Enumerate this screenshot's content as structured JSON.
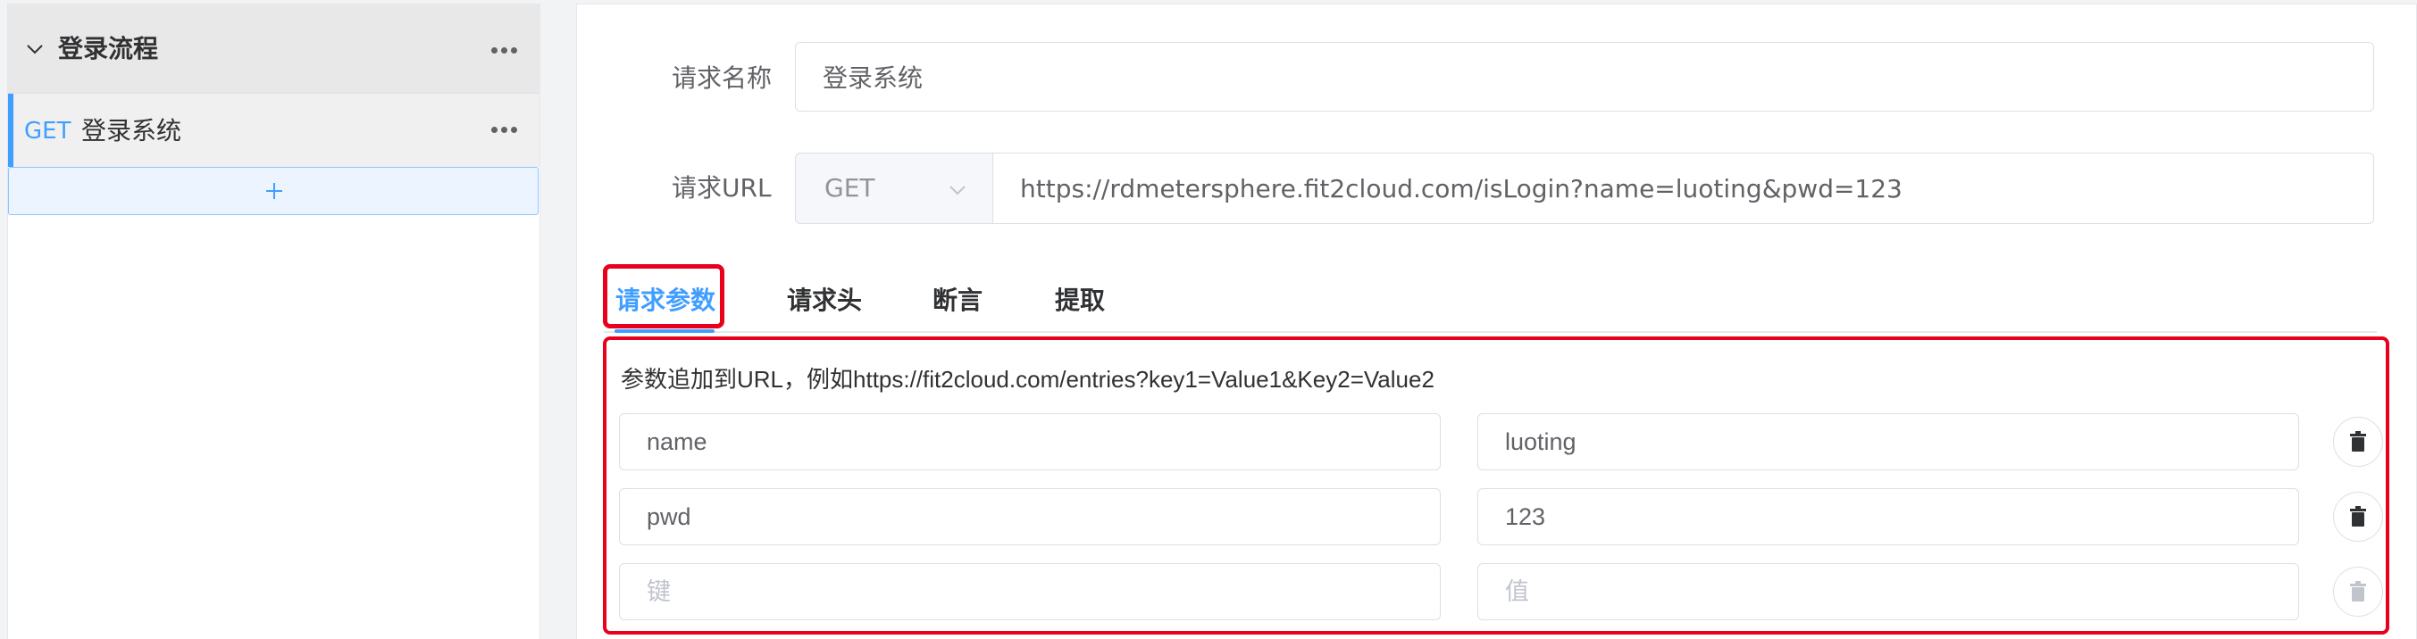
{
  "sidebar": {
    "scenario_title": "登录流程",
    "request": {
      "method": "GET",
      "name": "登录系统"
    }
  },
  "form": {
    "name_label": "请求名称",
    "name_value": "登录系统",
    "url_label": "请求URL",
    "method_value": "GET",
    "url_value": "https://rdmetersphere.fit2cloud.com/isLogin?name=luoting&pwd=123"
  },
  "tabs": [
    {
      "label": "请求参数"
    },
    {
      "label": "请求头"
    },
    {
      "label": "断言"
    },
    {
      "label": "提取"
    }
  ],
  "params": {
    "hint": "参数追加到URL，例如https://fit2cloud.com/entries?key1=Value1&Key2=Value2",
    "rows": [
      {
        "key": "name",
        "value": "luoting"
      },
      {
        "key": "pwd",
        "value": "123"
      },
      {
        "key": "",
        "value": ""
      }
    ],
    "key_placeholder": "键",
    "value_placeholder": "值"
  },
  "colors": {
    "accent": "#409eff",
    "highlight": "#e8001c"
  },
  "icons": {
    "collapse": "chevron-down-icon",
    "more": "more-horizontal-icon",
    "add": "plus-icon",
    "select_arrow": "chevron-down-icon",
    "delete": "trash-icon"
  }
}
